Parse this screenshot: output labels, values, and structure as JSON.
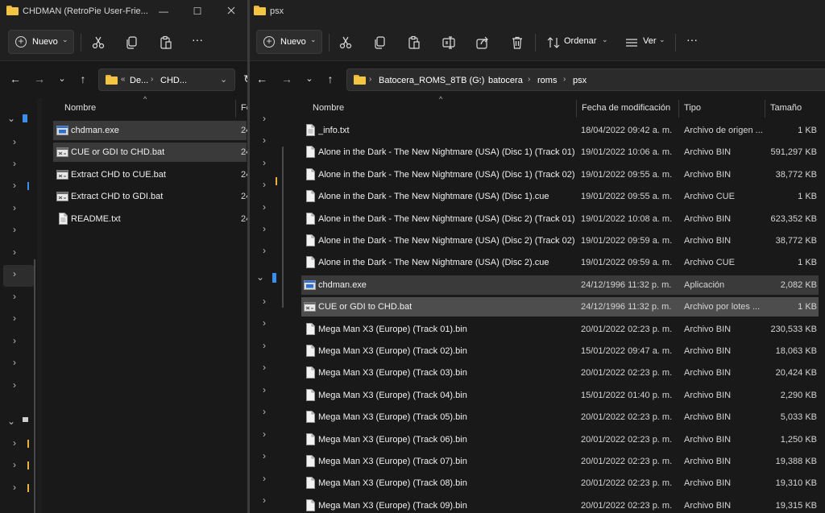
{
  "left_window": {
    "title": "CHDMAN (RetroPie User-Frie...",
    "window_controls": {
      "minimize": "—",
      "maximize": "☐"
    },
    "toolbar": {
      "new_label": "Nuevo"
    },
    "address": {
      "crumbs": [
        "De...",
        "CHD..."
      ],
      "overflow": "«"
    },
    "columns": {
      "name": "Nombre",
      "date_fragment": "Fe"
    },
    "files": [
      {
        "name": "chdman.exe",
        "date": "24",
        "icon": "exe-icon"
      },
      {
        "name": "CUE or GDI to CHD.bat",
        "date": "24",
        "icon": "bat-icon"
      },
      {
        "name": "Extract CHD to CUE.bat",
        "date": "24",
        "icon": "bat-icon"
      },
      {
        "name": "Extract CHD to GDI.bat",
        "date": "24",
        "icon": "bat-icon"
      },
      {
        "name": "README.txt",
        "date": "24",
        "icon": "txt-icon"
      }
    ]
  },
  "right_window": {
    "title": "psx",
    "toolbar": {
      "new_label": "Nuevo",
      "sort_label": "Ordenar",
      "view_label": "Ver",
      "more": "..."
    },
    "address": {
      "crumbs": [
        "Batocera_ROMS_8TB (G:)",
        "batocera",
        "roms",
        "psx"
      ]
    },
    "columns": {
      "name": "Nombre",
      "date": "Fecha de modificación",
      "type": "Tipo",
      "size": "Tamaño"
    },
    "files": [
      {
        "name": "_info.txt",
        "date": "18/04/2022 09:42 a. m.",
        "type": "Archivo de origen ...",
        "size": "1 KB",
        "icon": "txt-icon"
      },
      {
        "name": "Alone in the Dark - The New Nightmare (USA) (Disc 1) (Track 01).bin",
        "date": "19/01/2022 10:06 a. m.",
        "type": "Archivo BIN",
        "size": "591,297 KB",
        "icon": "file-icon"
      },
      {
        "name": "Alone in the Dark - The New Nightmare (USA) (Disc 1) (Track 02).bin",
        "date": "19/01/2022 09:55 a. m.",
        "type": "Archivo BIN",
        "size": "38,772 KB",
        "icon": "file-icon"
      },
      {
        "name": "Alone in the Dark - The New Nightmare (USA) (Disc 1).cue",
        "date": "19/01/2022 09:55 a. m.",
        "type": "Archivo CUE",
        "size": "1 KB",
        "icon": "file-icon"
      },
      {
        "name": "Alone in the Dark - The New Nightmare (USA) (Disc 2) (Track 01).bin",
        "date": "19/01/2022 10:08 a. m.",
        "type": "Archivo BIN",
        "size": "623,352 KB",
        "icon": "file-icon"
      },
      {
        "name": "Alone in the Dark - The New Nightmare (USA) (Disc 2) (Track 02).bin",
        "date": "19/01/2022 09:59 a. m.",
        "type": "Archivo BIN",
        "size": "38,772 KB",
        "icon": "file-icon"
      },
      {
        "name": "Alone in the Dark - The New Nightmare (USA) (Disc 2).cue",
        "date": "19/01/2022 09:59 a. m.",
        "type": "Archivo CUE",
        "size": "1 KB",
        "icon": "file-icon"
      },
      {
        "name": "chdman.exe",
        "date": "24/12/1996 11:32 p. m.",
        "type": "Aplicación",
        "size": "2,082 KB",
        "icon": "exe-icon"
      },
      {
        "name": "CUE or GDI to CHD.bat",
        "date": "24/12/1996 11:32 p. m.",
        "type": "Archivo por lotes ...",
        "size": "1 KB",
        "icon": "bat-icon"
      },
      {
        "name": "Mega Man X3 (Europe) (Track 01).bin",
        "date": "20/01/2022 02:23 p. m.",
        "type": "Archivo BIN",
        "size": "230,533 KB",
        "icon": "file-icon"
      },
      {
        "name": "Mega Man X3 (Europe) (Track 02).bin",
        "date": "15/01/2022 09:47 a. m.",
        "type": "Archivo BIN",
        "size": "18,063 KB",
        "icon": "file-icon"
      },
      {
        "name": "Mega Man X3 (Europe) (Track 03).bin",
        "date": "20/01/2022 02:23 p. m.",
        "type": "Archivo BIN",
        "size": "20,424 KB",
        "icon": "file-icon"
      },
      {
        "name": "Mega Man X3 (Europe) (Track 04).bin",
        "date": "15/01/2022 01:40 p. m.",
        "type": "Archivo BIN",
        "size": "2,290 KB",
        "icon": "file-icon"
      },
      {
        "name": "Mega Man X3 (Europe) (Track 05).bin",
        "date": "20/01/2022 02:23 p. m.",
        "type": "Archivo BIN",
        "size": "5,033 KB",
        "icon": "file-icon"
      },
      {
        "name": "Mega Man X3 (Europe) (Track 06).bin",
        "date": "20/01/2022 02:23 p. m.",
        "type": "Archivo BIN",
        "size": "1,250 KB",
        "icon": "file-icon"
      },
      {
        "name": "Mega Man X3 (Europe) (Track 07).bin",
        "date": "20/01/2022 02:23 p. m.",
        "type": "Archivo BIN",
        "size": "19,388 KB",
        "icon": "file-icon"
      },
      {
        "name": "Mega Man X3 (Europe) (Track 08).bin",
        "date": "20/01/2022 02:23 p. m.",
        "type": "Archivo BIN",
        "size": "19,310 KB",
        "icon": "file-icon"
      },
      {
        "name": "Mega Man X3 (Europe) (Track 09).bin",
        "date": "20/01/2022 02:23 p. m.",
        "type": "Archivo BIN",
        "size": "19,315 KB",
        "icon": "file-icon"
      }
    ]
  },
  "colors": {
    "background": "#191919",
    "toolbar": "#202020",
    "selection": "#4d4d4d",
    "folder": "#f4c542",
    "accent": "#3b8eea"
  }
}
